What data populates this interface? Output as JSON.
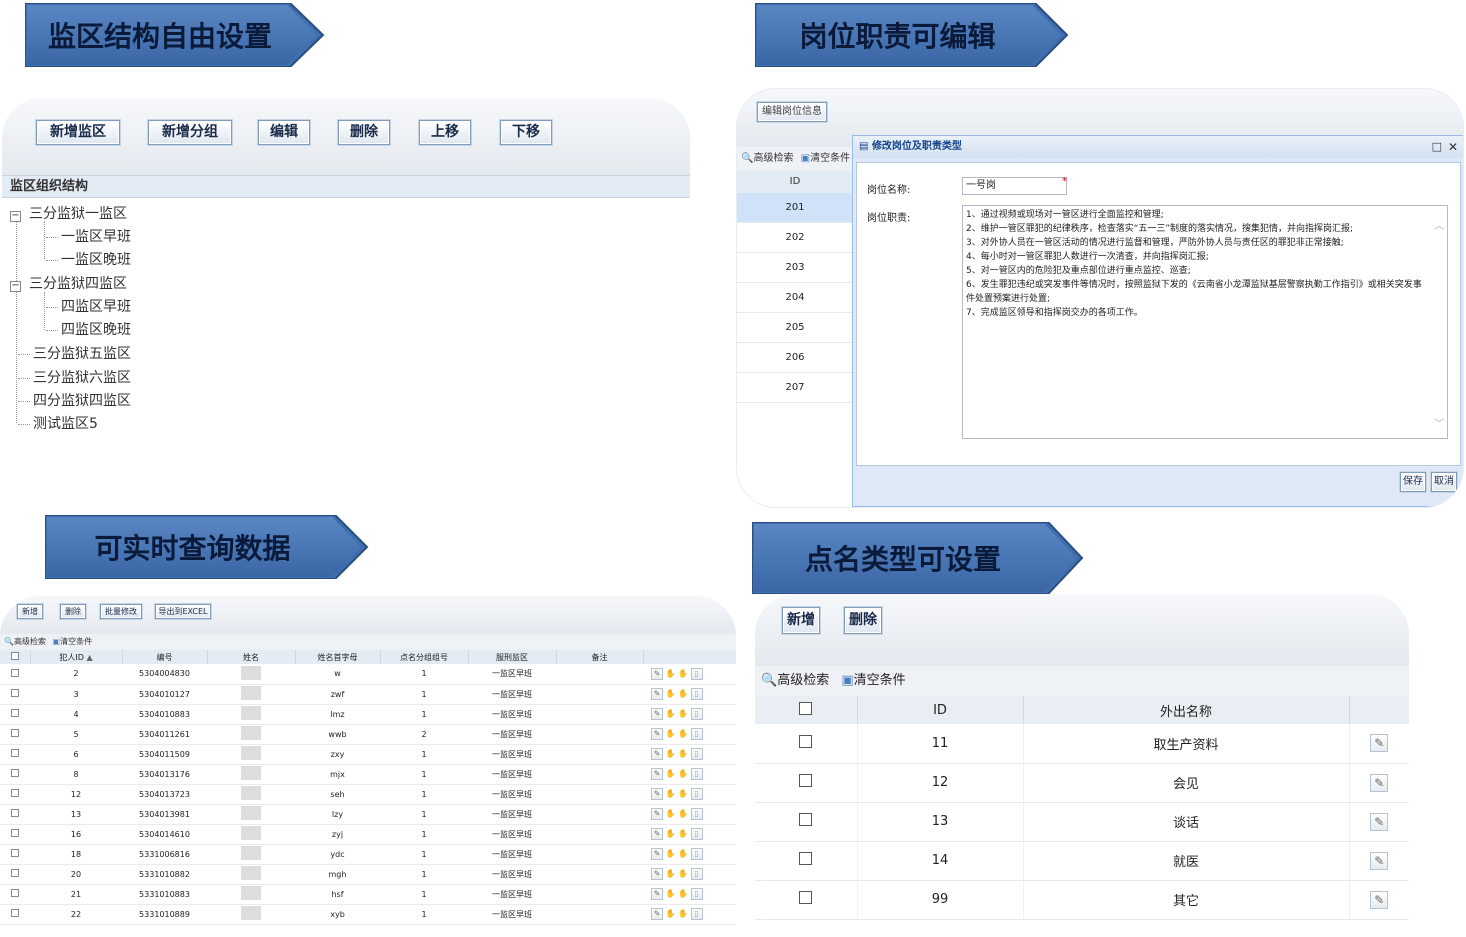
{
  "banners": {
    "b1": "监区结构自由设置",
    "b2": "岗位职责可编辑",
    "b3": "可实时查询数据",
    "b4": "点名类型可设置"
  },
  "p1": {
    "buttons": [
      "新增监区",
      "新增分组",
      "编辑",
      "删除",
      "上移",
      "下移"
    ],
    "tree_title": "监区组织结构",
    "tree": {
      "n1": "三分监狱一监区",
      "n1a": "一监区早班",
      "n1b": "一监区晚班",
      "n2": "三分监狱四监区",
      "n2a": "四监区早班",
      "n2b": "四监区晚班",
      "n3": "三分监狱五监区",
      "n4": "三分监狱六监区",
      "n5": "四分监狱四监区",
      "n6": "测试监区5"
    }
  },
  "p2": {
    "bg_tab": "编辑岗位信息",
    "search": "高级检索",
    "clear": "清空条件",
    "id_header": "ID",
    "ids": [
      "201",
      "202",
      "203",
      "204",
      "205",
      "206",
      "207"
    ],
    "dialog": {
      "title": "修改岗位及职责类型",
      "name_label": "岗位名称:",
      "name_value": "一号岗",
      "duty_label": "岗位职责:",
      "duties": [
        "1、通过视频或现场对一管区进行全面监控和管理;",
        "2、维护一管区罪犯的纪律秩序，检查落实“五一三”制度的落实情况，搜集犯情，并向指挥岗汇报;",
        "3、对外协人员在一管区活动的情况进行监督和管理，严防外协人员与责任区的罪犯非正常接触;",
        "4、每小时对一管区罪犯人数进行一次清查，并向指挥岗汇报;",
        "5、对一管区内的危险犯及重点部位进行重点监控、巡查;",
        "6、发生罪犯违纪或突发事件等情况时，按照监狱下发的《云南省小龙潭监狱基层警察执勤工作指引》或相关突发事件处置预案进行处置;",
        "7、完成监区领导和指挥岗交办的各项工作。"
      ],
      "save": "保存",
      "cancel": "取消"
    }
  },
  "p3": {
    "buttons": [
      "新增",
      "删除",
      "批量修改",
      "导出到EXCEL"
    ],
    "search": "高级检索",
    "clear": "清空条件",
    "headers": [
      "犯人ID",
      "编号",
      "姓名",
      "姓名首字母",
      "点名分组组号",
      "服刑监区",
      "备注"
    ],
    "rows": [
      {
        "id": "2",
        "code": "5304004830",
        "initials": "w",
        "group": "1",
        "area": "一监区早班"
      },
      {
        "id": "3",
        "code": "5304010127",
        "initials": "zwf",
        "group": "1",
        "area": "一监区早班"
      },
      {
        "id": "4",
        "code": "5304010883",
        "initials": "lmz",
        "group": "1",
        "area": "一监区早班"
      },
      {
        "id": "5",
        "code": "5304011261",
        "initials": "wwb",
        "group": "2",
        "area": "一监区早班"
      },
      {
        "id": "6",
        "code": "5304011509",
        "initials": "zxy",
        "group": "1",
        "area": "一监区早班"
      },
      {
        "id": "8",
        "code": "5304013176",
        "initials": "mjx",
        "group": "1",
        "area": "一监区早班"
      },
      {
        "id": "12",
        "code": "5304013723",
        "initials": "seh",
        "group": "1",
        "area": "一监区早班"
      },
      {
        "id": "13",
        "code": "5304013981",
        "initials": "lzy",
        "group": "1",
        "area": "一监区早班"
      },
      {
        "id": "16",
        "code": "5304014610",
        "initials": "zyj",
        "group": "1",
        "area": "一监区早班"
      },
      {
        "id": "18",
        "code": "5331006816",
        "initials": "ydc",
        "group": "1",
        "area": "一监区早班"
      },
      {
        "id": "20",
        "code": "5331010882",
        "initials": "mgh",
        "group": "1",
        "area": "一监区早班"
      },
      {
        "id": "21",
        "code": "5331010883",
        "initials": "hsf",
        "group": "1",
        "area": "一监区早班"
      },
      {
        "id": "22",
        "code": "5331010889",
        "initials": "xyb",
        "group": "1",
        "area": "一监区早班"
      }
    ]
  },
  "p4": {
    "buttons": [
      "新增",
      "删除"
    ],
    "search": "高级检索",
    "clear": "清空条件",
    "headers": [
      "ID",
      "外出名称"
    ],
    "rows": [
      {
        "id": "11",
        "name": "取生产资料"
      },
      {
        "id": "12",
        "name": "会见"
      },
      {
        "id": "13",
        "name": "谈话"
      },
      {
        "id": "14",
        "name": "就医"
      },
      {
        "id": "99",
        "name": "其它"
      }
    ]
  },
  "colors": {
    "banner": "#3f6faf",
    "border": "#99bbe8",
    "header": "#e3ebf4",
    "selected": "#cfe2f7"
  }
}
